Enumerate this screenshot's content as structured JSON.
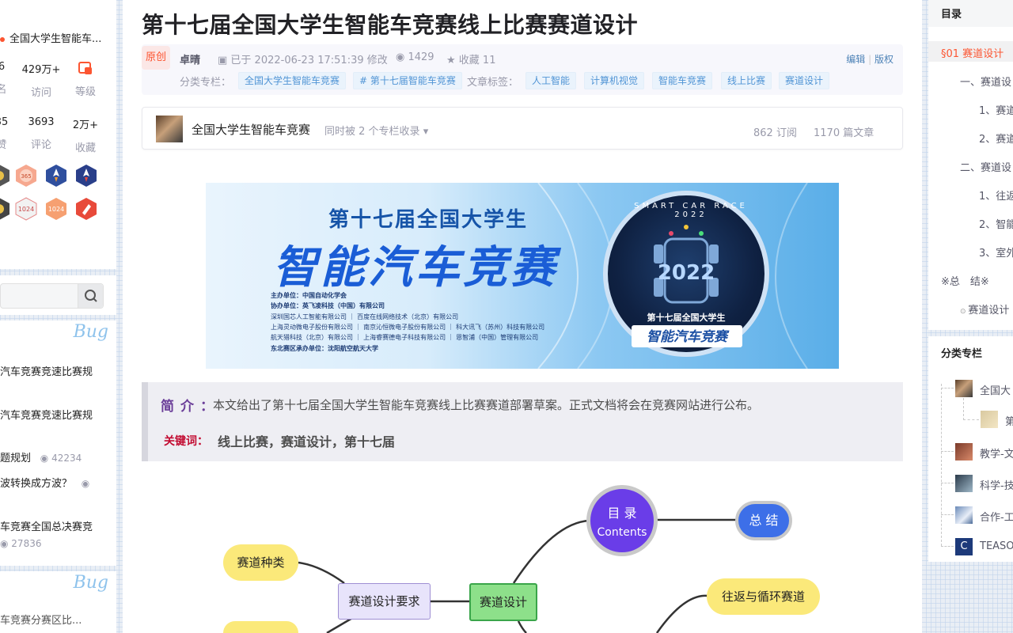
{
  "left": {
    "profile_name": "全国大学生智能车...",
    "stats_row1": [
      {
        "value": "6",
        "label": "名"
      },
      {
        "value": "429万+",
        "label": "访问"
      },
      {
        "value": "",
        "label": "等级"
      }
    ],
    "stats_row2": [
      {
        "value": "35",
        "label": "赞"
      },
      {
        "value": "3693",
        "label": "评论"
      },
      {
        "value": "2万+",
        "label": "收藏"
      }
    ],
    "badge_labels": [
      "1024",
      "1024"
    ],
    "bug_tag": "Bug",
    "hot_items": [
      {
        "title": "汽车竞赛竞速比赛规",
        "views": ""
      },
      {
        "title": "汽车竞赛竞速比赛规",
        "views": ""
      },
      {
        "title": "题规划",
        "views": "42234"
      },
      {
        "title": "波转换成方波？",
        "views": ""
      },
      {
        "title": "车竞赛全国总决赛竞",
        "views": "27836"
      },
      {
        "title": "车竞赛分赛区比...",
        "views": ""
      }
    ]
  },
  "article": {
    "title": "第十七届全国大学生智能车竞赛线上比赛赛道设计",
    "original_badge": "原创",
    "author": "卓晴",
    "modified_text": "已于 2022-06-23 17:51:39 修改",
    "views": "1429",
    "favorites_text": "收藏 11",
    "edit_link": "编辑",
    "copyright_link": "版权",
    "category_label": "分类专栏：",
    "categories": [
      "全国大学生智能车竞赛",
      "# 第十七届智能车竞赛"
    ],
    "tags_label": "文章标签：",
    "tags": [
      "人工智能",
      "计算机视觉",
      "智能车竞赛",
      "线上比赛",
      "赛道设计"
    ]
  },
  "column_card": {
    "name": "全国大学生智能车竞赛",
    "sub": "同时被 2 个专栏收录",
    "subscriptions": "862 订阅",
    "articles": "1170 篇文章"
  },
  "banner": {
    "line1": "第十七届全国大学生",
    "line2": "智能汽车竞赛",
    "orgs": [
      "主办单位：中国自动化学会",
      "协办单位：英飞凌科技（中国）有限公司",
      "深圳国芯人工智能有限公司 ｜ 百度在线网络技术（北京）有限公司",
      "上海灵动微电子股份有限公司 ｜ 南京沁恒微电子股份有限公司 ｜ 科大讯飞（苏州）科技有限公司",
      "航天猎科技（北京）有限公司 ｜ 上海睿赛德电子科技有限公司 ｜ 恩智浦（中国）管理有限公司",
      "东北赛区承办单位：沈阳航空航天大学"
    ],
    "circle_ring": "SMART CAR RACE 2022",
    "circle_year": "2022",
    "circle_sub": "第十七届全国大学生",
    "circle_main": "智能汽车竞赛"
  },
  "abstract": {
    "label": "简介：",
    "text": "本文给出了第十七届全国大学生智能车竞赛线上比赛赛道部署草案。正式文档将会在竞赛网站进行公布。",
    "keywords_label": "关键词：",
    "keywords": "线上比赛，赛道设计，第十七届"
  },
  "mindmap": {
    "center": "赛道设计",
    "requirements": "赛道设计要求",
    "types": "赛道种类",
    "toc_line1": "目 录",
    "toc_line2": "Contents",
    "summary": "总 结",
    "loop": "往返与循环赛道"
  },
  "toc": {
    "title": "目录",
    "items": [
      "§01 赛道设计",
      "一、赛道设",
      "1、赛道",
      "2、赛道",
      "二、赛道设",
      "1、往返",
      "2、智能",
      "3、室外",
      "※总　结※",
      "赛道设计"
    ]
  },
  "category_panel": {
    "title": "分类专栏",
    "items": [
      "全国大",
      "第",
      "教学-文",
      "科学-技",
      "合作-工",
      "TEASO"
    ]
  },
  "colors": {
    "accent": "#fc5531",
    "tag_blue": "#5094d5",
    "mindmap_center": "#8de08a",
    "mindmap_circle": "#6a3de8",
    "mindmap_summary": "#3d6fe8",
    "mindmap_yellow": "#fbe97a"
  }
}
